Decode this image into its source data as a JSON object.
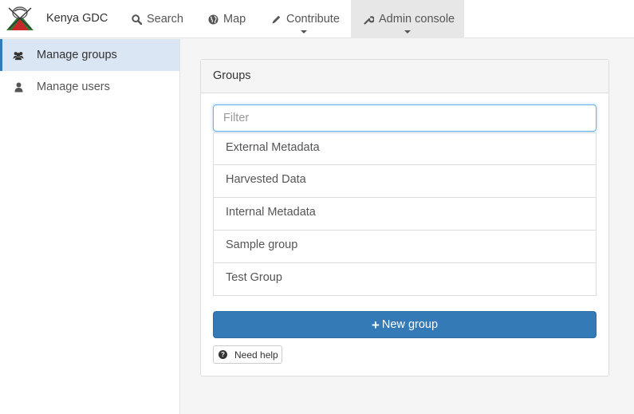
{
  "navbar": {
    "brand": "Kenya GDC",
    "items": [
      {
        "label": "Search",
        "icon": "search-icon"
      },
      {
        "label": "Map",
        "icon": "globe-icon"
      },
      {
        "label": "Contribute",
        "icon": "pencil-icon"
      },
      {
        "label": "Admin console",
        "icon": "wrench-icon"
      }
    ]
  },
  "sidebar": {
    "items": [
      {
        "label": "Manage groups",
        "icon": "users-icon",
        "active": true
      },
      {
        "label": "Manage users",
        "icon": "user-icon",
        "active": false
      }
    ]
  },
  "panel": {
    "title": "Groups",
    "filter_placeholder": "Filter",
    "groups": [
      "External Metadata",
      "Harvested Data",
      "Internal Metadata",
      "Sample group",
      "Test Group"
    ],
    "new_button": "New group",
    "help_button": "Need help"
  },
  "colors": {
    "accent": "#337ab7",
    "active_sidebar_bg": "#dae6f3",
    "active_nav_bg": "#e7e7e7"
  }
}
